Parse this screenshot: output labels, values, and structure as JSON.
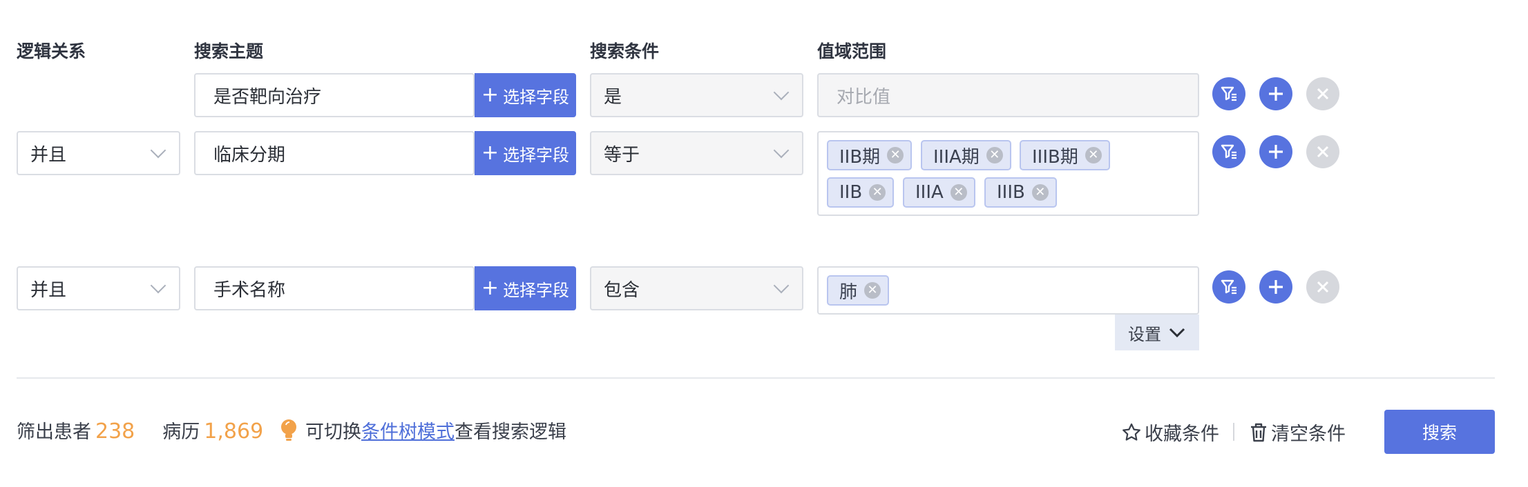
{
  "headers": {
    "logic": "逻辑关系",
    "topic": "搜索主题",
    "condition": "搜索条件",
    "range": "值域范围"
  },
  "rows": [
    {
      "logic": "",
      "topic": "是否靶向治疗",
      "pick_label": "选择字段",
      "condition": "是",
      "range_placeholder": "对比值",
      "tags": []
    },
    {
      "logic": "并且",
      "topic": "临床分期",
      "pick_label": "选择字段",
      "condition": "等于",
      "tags": [
        "IIB期",
        "IIIA期",
        "IIIB期",
        "IIB",
        "IIIA",
        "IIIB"
      ]
    },
    {
      "logic": "并且",
      "topic": "手术名称",
      "pick_label": "选择字段",
      "condition": "包含",
      "tags": [
        "肺"
      ]
    }
  ],
  "settings_label": "设置",
  "footer": {
    "patients_label": "筛出患者",
    "patients_count": "238",
    "records_label": "病历",
    "records_count": "1,869",
    "tip_prefix": "可切换",
    "tip_link": "条件树模式",
    "tip_suffix": "查看搜索逻辑",
    "favorite_label": "收藏条件",
    "clear_label": "清空条件",
    "search_label": "搜索"
  },
  "colors": {
    "accent": "#5773df",
    "count": "#f2a24a",
    "tag_bg": "#e2e7f7"
  }
}
